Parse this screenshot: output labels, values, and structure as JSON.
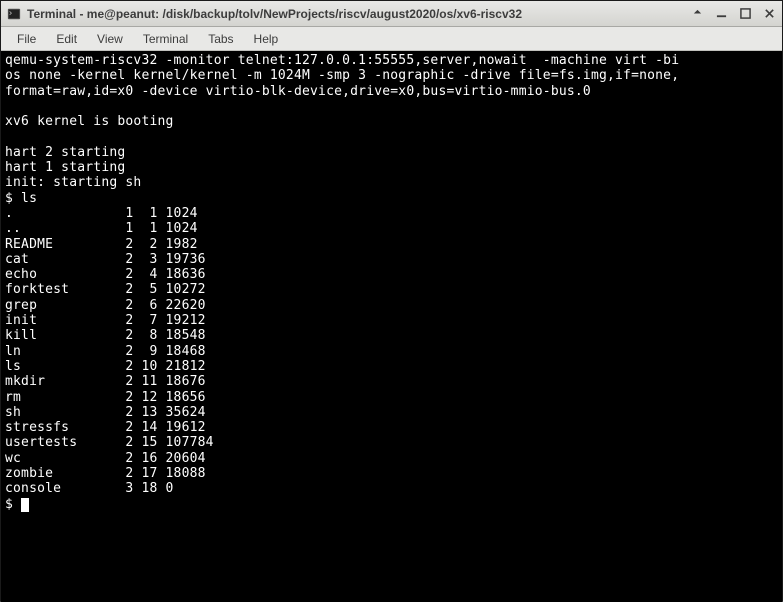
{
  "window": {
    "title": "Terminal - me@peanut: /disk/backup/tolv/NewProjects/riscv/august2020/os/xv6-riscv32"
  },
  "menu": {
    "file": "File",
    "edit": "Edit",
    "view": "View",
    "terminal": "Terminal",
    "tabs": "Tabs",
    "help": "Help"
  },
  "terminal": {
    "cmd_line1": "qemu-system-riscv32 -monitor telnet:127.0.0.1:55555,server,nowait  -machine virt -bi",
    "cmd_line2": "os none -kernel kernel/kernel -m 1024M -smp 3 -nographic -drive file=fs.img,if=none,",
    "cmd_line3": "format=raw,id=x0 -device virtio-blk-device,drive=x0,bus=virtio-mmio-bus.0",
    "boot_msg": "xv6 kernel is booting",
    "hart2": "hart 2 starting",
    "hart1": "hart 1 starting",
    "init_msg": "init: starting sh",
    "prompt_ls": "$ ls",
    "files": [
      {
        "name": ".",
        "c1": "1",
        "c2": "1",
        "size": "1024"
      },
      {
        "name": "..",
        "c1": "1",
        "c2": "1",
        "size": "1024"
      },
      {
        "name": "README",
        "c1": "2",
        "c2": "2",
        "size": "1982"
      },
      {
        "name": "cat",
        "c1": "2",
        "c2": "3",
        "size": "19736"
      },
      {
        "name": "echo",
        "c1": "2",
        "c2": "4",
        "size": "18636"
      },
      {
        "name": "forktest",
        "c1": "2",
        "c2": "5",
        "size": "10272"
      },
      {
        "name": "grep",
        "c1": "2",
        "c2": "6",
        "size": "22620"
      },
      {
        "name": "init",
        "c1": "2",
        "c2": "7",
        "size": "19212"
      },
      {
        "name": "kill",
        "c1": "2",
        "c2": "8",
        "size": "18548"
      },
      {
        "name": "ln",
        "c1": "2",
        "c2": "9",
        "size": "18468"
      },
      {
        "name": "ls",
        "c1": "2",
        "c2": "10",
        "size": "21812"
      },
      {
        "name": "mkdir",
        "c1": "2",
        "c2": "11",
        "size": "18676"
      },
      {
        "name": "rm",
        "c1": "2",
        "c2": "12",
        "size": "18656"
      },
      {
        "name": "sh",
        "c1": "2",
        "c2": "13",
        "size": "35624"
      },
      {
        "name": "stressfs",
        "c1": "2",
        "c2": "14",
        "size": "19612"
      },
      {
        "name": "usertests",
        "c1": "2",
        "c2": "15",
        "size": "107784"
      },
      {
        "name": "wc",
        "c1": "2",
        "c2": "16",
        "size": "20604"
      },
      {
        "name": "zombie",
        "c1": "2",
        "c2": "17",
        "size": "18088"
      },
      {
        "name": "console",
        "c1": "3",
        "c2": "18",
        "size": "0"
      }
    ],
    "prompt_end": "$ "
  }
}
